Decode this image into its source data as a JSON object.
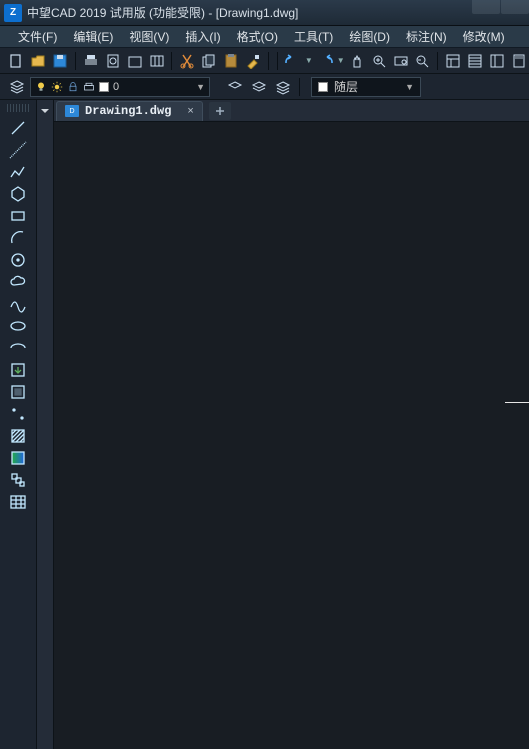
{
  "title": "中望CAD 2019 试用版 (功能受限) - [Drawing1.dwg]",
  "menu": [
    "文件(F)",
    "编辑(E)",
    "视图(V)",
    "插入(I)",
    "格式(O)",
    "工具(T)",
    "绘图(D)",
    "标注(N)",
    "修改(M)"
  ],
  "layer": {
    "value": "0"
  },
  "prop": {
    "label": "随层"
  },
  "tab": {
    "label": "Drawing1.dwg",
    "close": "×",
    "new": "+"
  }
}
